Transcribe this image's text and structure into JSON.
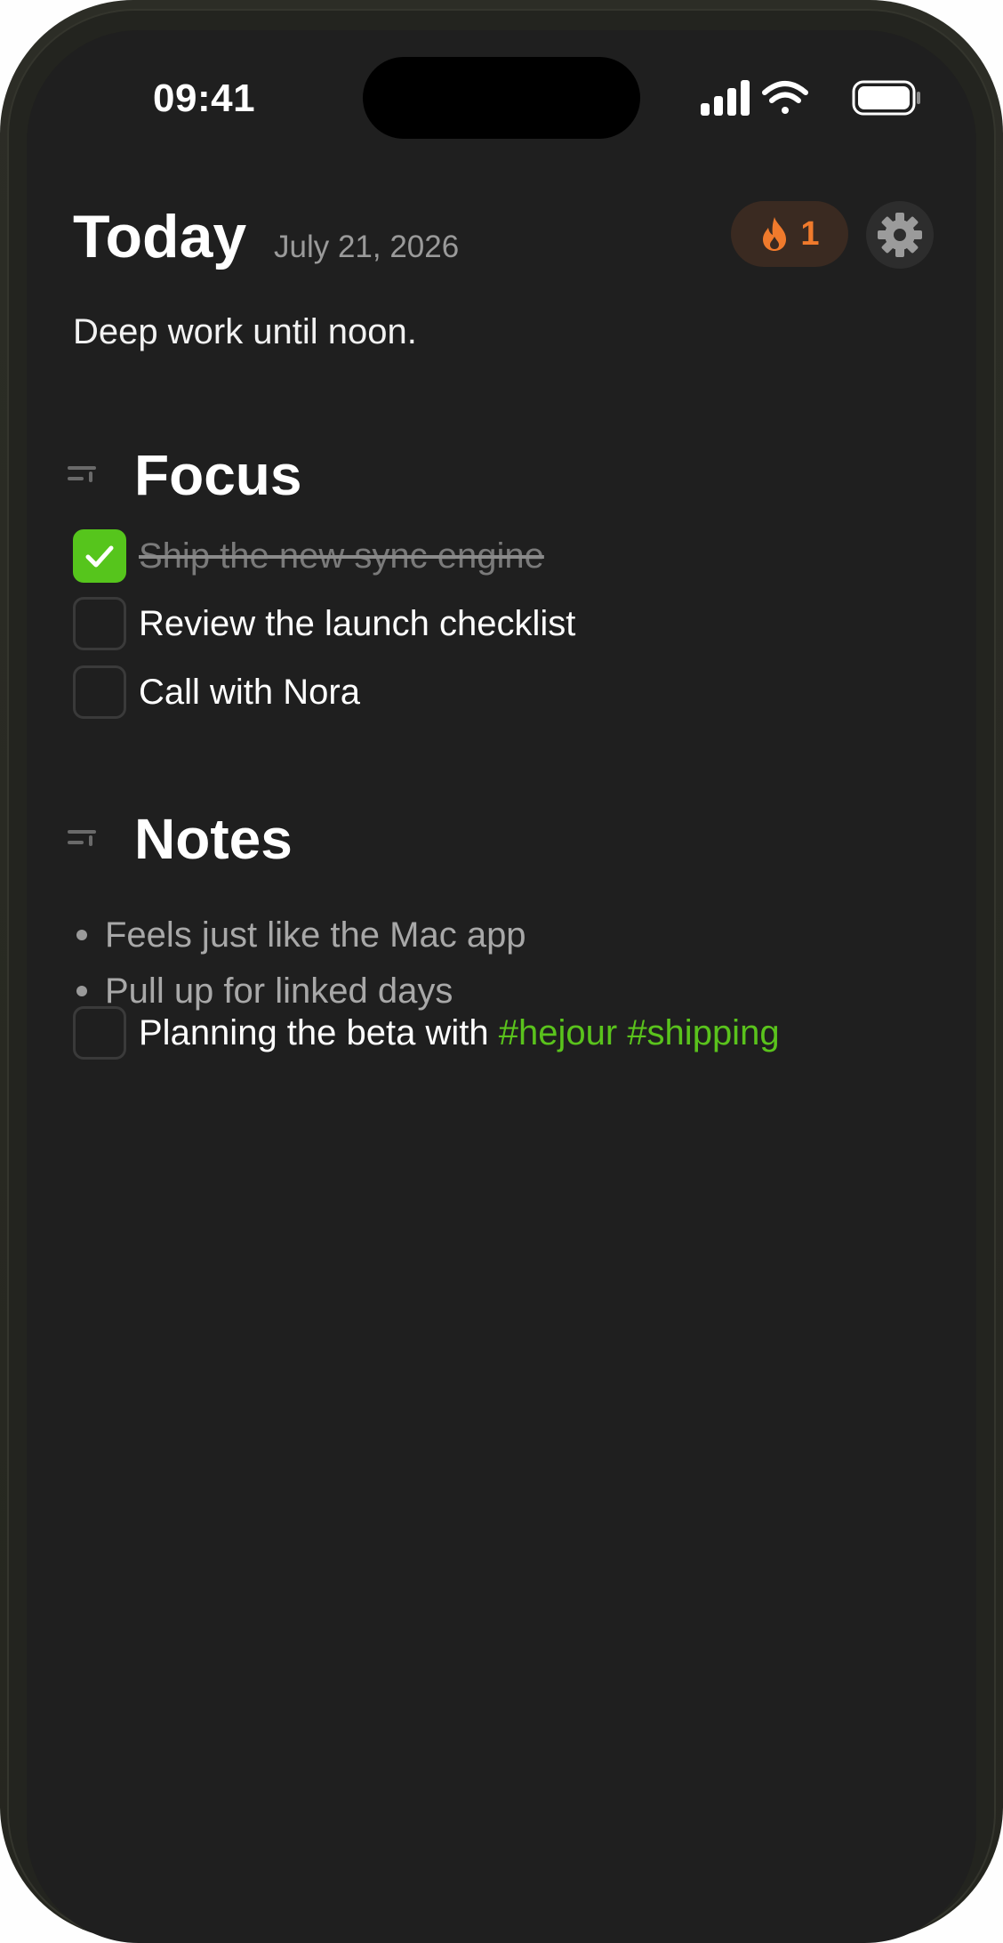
{
  "status_bar": {
    "time": "09:41"
  },
  "header": {
    "title": "Today",
    "date": "July 21, 2026",
    "streak_count": "1",
    "subtitle": "Deep work until noon."
  },
  "sections": {
    "focus": {
      "title": "Focus",
      "tasks": [
        {
          "label": "Ship the new sync engine",
          "checked": true
        },
        {
          "label": "Review the launch checklist",
          "checked": false
        },
        {
          "label": "Call with Nora",
          "checked": false
        }
      ]
    },
    "notes": {
      "title": "Notes",
      "bullets": [
        "Feels just like the Mac app",
        "Pull up for linked days"
      ],
      "task": {
        "label": "Planning the beta with",
        "tag_1": "#hejour",
        "tag_2": "#shipping",
        "checked": false
      }
    }
  },
  "colors": {
    "background": "#1f1f1f",
    "accent_green": "#56c51c",
    "streak_orange": "#f07a2c",
    "muted_text": "#9a9a9a"
  },
  "icons": {
    "streak": "flame-icon",
    "settings": "gear-icon",
    "signal": "cellular-signal-icon",
    "wifi": "wifi-icon",
    "battery": "battery-icon",
    "section_handle": "drag-handle-icon",
    "check": "checkmark-icon"
  }
}
